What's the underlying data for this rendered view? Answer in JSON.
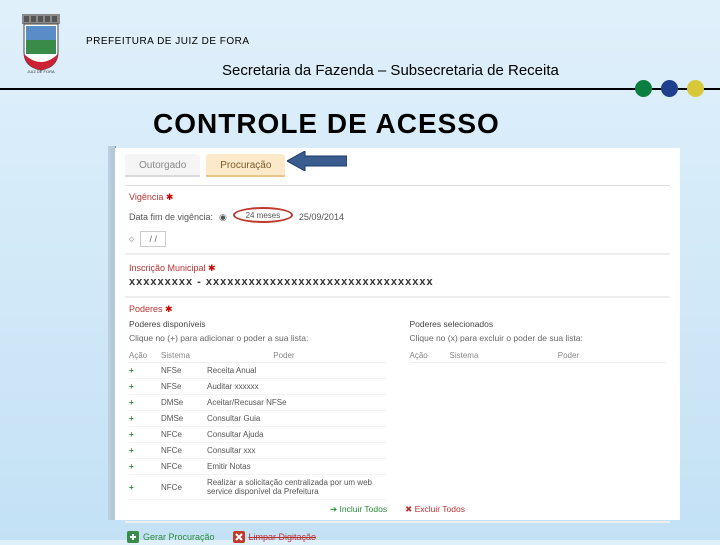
{
  "header": {
    "prefeitura": "PREFEITURA DE JUIZ DE FORA",
    "secretaria": "Secretaria da Fazenda – Subsecretaria de Receita"
  },
  "section_title": "CONTROLE  DE  ACESSO",
  "tabs": {
    "t1": "Outorgado",
    "t2": "Procuração"
  },
  "vigencia": {
    "label": "Vigência",
    "data_label": "Data fim de vigência:",
    "radio_24": "24 meses",
    "date_fixed": "25/09/2014",
    "date_input": "  /   /"
  },
  "inscricao": {
    "label": "Inscrição Municipal",
    "numero": "xxxxxxxxx",
    "sep": "-",
    "nome": "xxxxxxxxxxxxxxxxxxxxxxxxxxxxxxxx"
  },
  "poderes": {
    "label": "Poderes",
    "disponiveis": "Poderes disponíveis",
    "selecionados": "Poderes selecionados",
    "dica_add": "Clique no (+) para adicionar o poder a sua lista:",
    "dica_rem": "Clique no (x) para excluir o poder de sua lista:"
  },
  "table_head": {
    "acao": "Ação",
    "sistema": "Sistema",
    "poder": "Poder"
  },
  "rows": [
    {
      "sistema": "NFSe",
      "poder": "Receita Anual"
    },
    {
      "sistema": "NFSe",
      "poder": "Auditar xxxxxx"
    },
    {
      "sistema": "DMSe",
      "poder": "Aceitar/Recusar NFSe"
    },
    {
      "sistema": "DMSe",
      "poder": "Consultar Guia"
    },
    {
      "sistema": "NFCe",
      "poder": "Consultar Ajuda"
    },
    {
      "sistema": "NFCe",
      "poder": "Consultar xxx"
    },
    {
      "sistema": "NFCe",
      "poder": "Emitir Notas"
    },
    {
      "sistema": "NFCe",
      "poder": "Realizar a solicitação centralizada por um web service disponível da Prefeitura"
    }
  ],
  "right_head": {
    "acao": "Ação",
    "sistema": "Sistema",
    "poder": "Poder"
  },
  "incluir_excluir": {
    "inc": "Incluir Todos",
    "exc": "Excluir Todos"
  },
  "footer": {
    "gerar": "Gerar Procuração",
    "limpar": "Limpar Digitação"
  }
}
